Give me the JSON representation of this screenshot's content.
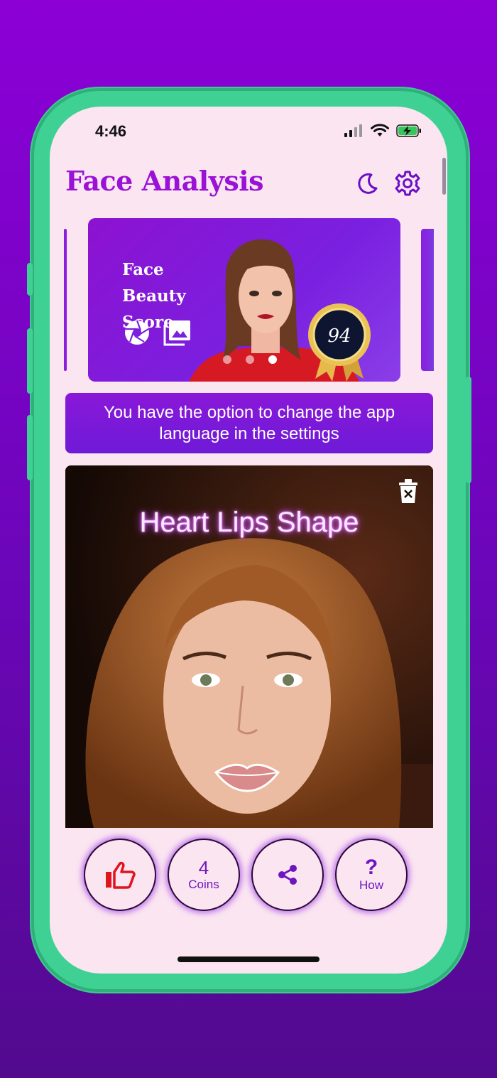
{
  "status_bar": {
    "time": "4:46"
  },
  "header": {
    "title": "Face Analysis",
    "icons": [
      "moon-icon",
      "gear-icon"
    ]
  },
  "banner": {
    "title": "Face Beauty Score",
    "badge_value": "94",
    "icons": [
      "camera-shutter-icon",
      "gallery-icon"
    ],
    "carousel_page": 3,
    "carousel_total": 3
  },
  "notice": {
    "text": "You have the option to change the app language in the settings"
  },
  "photo": {
    "title": "Heart Lips Shape",
    "icons": [
      "trash-icon"
    ]
  },
  "actions": {
    "like_icon": "thumbs-up-icon",
    "coins_value": "4",
    "coins_label": "Coins",
    "share_icon": "share-icon",
    "how_symbol": "?",
    "how_label": "How"
  },
  "colors": {
    "accent": "#9a12d6",
    "frame": "#3fd193",
    "screen_bg": "#fbe5f1",
    "like_red": "#e0141e"
  }
}
